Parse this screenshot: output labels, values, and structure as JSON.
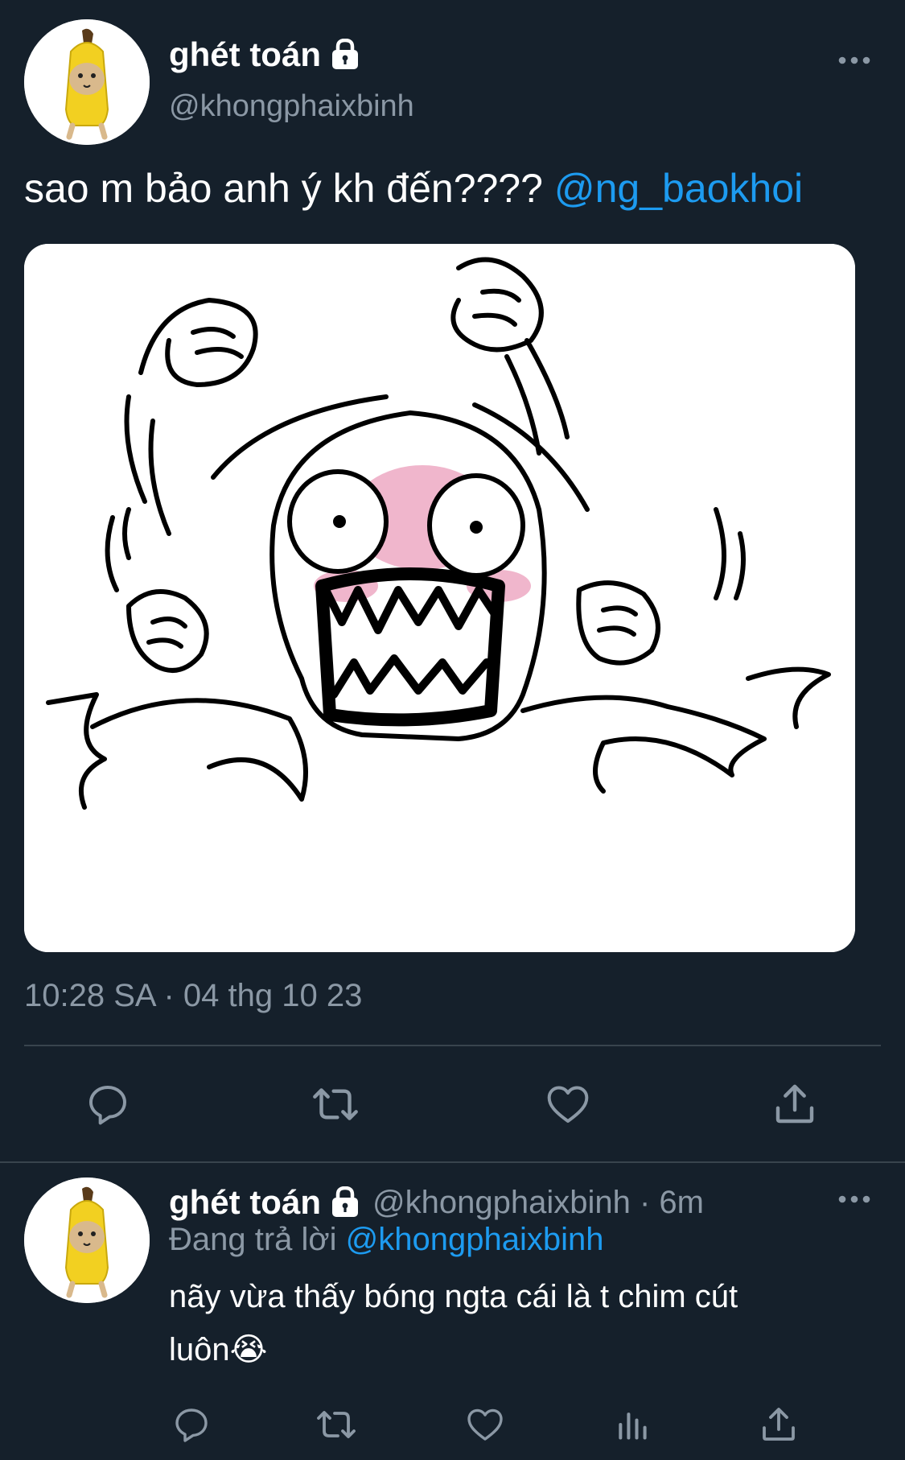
{
  "main_tweet": {
    "display_name": "ghét toán",
    "handle": "@khongphaixbinh",
    "text": "sao m bảo anh ý kh đến????",
    "mention": "@ng_baokhoi",
    "timestamp": "10:28 SA · 04 thg 10 23",
    "icons": [
      "lock-icon",
      "more-icon",
      "reply-icon",
      "retweet-icon",
      "like-icon",
      "share-icon"
    ]
  },
  "reply_tweet": {
    "display_name": "ghét toán",
    "handle_time": "@khongphaixbinh · 6m",
    "replying_prefix": "Đang trả lời",
    "replying_to": "@khongphaixbinh",
    "text_line1": "nãy vừa thấy bóng ngta cái là t chim cút",
    "text_line2": "luôn",
    "emoji": "😭",
    "icons": [
      "reply-icon",
      "retweet-icon",
      "like-icon",
      "analytics-icon",
      "share-icon"
    ]
  },
  "colors": {
    "background": "#15202b",
    "text": "#ffffff",
    "secondary_text": "#8b98a5",
    "accent": "#1d9bf0",
    "divider": "#38444d"
  }
}
